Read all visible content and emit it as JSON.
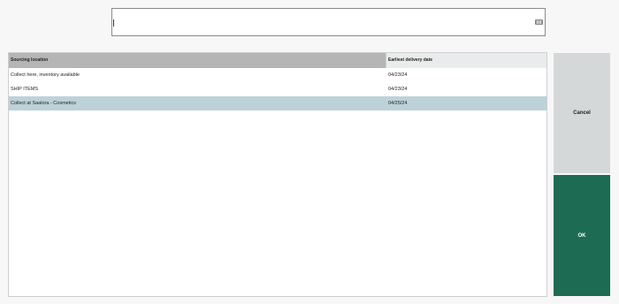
{
  "search": {
    "value": "",
    "placeholder": "",
    "keyboard_icon": "keyboard-icon"
  },
  "grid": {
    "columns": [
      "Sourcing location",
      "Earliest delivery date"
    ],
    "rows": [
      {
        "location": "Collect here, inventory available",
        "date": "04/23/24",
        "selected": false
      },
      {
        "location": "SHIP ITEMS",
        "date": "04/23/24",
        "selected": false
      },
      {
        "location": "Collect at Saalora - Cosmetics",
        "date": "04/25/24",
        "selected": true
      }
    ],
    "selected_color": "#bcd2d8"
  },
  "buttons": {
    "cancel_label": "Cancel",
    "ok_label": "OK"
  },
  "colors": {
    "ok_bg": "#1d6b52",
    "cancel_bg": "#d5d8d9",
    "header_bg": "#b5b5b5"
  }
}
